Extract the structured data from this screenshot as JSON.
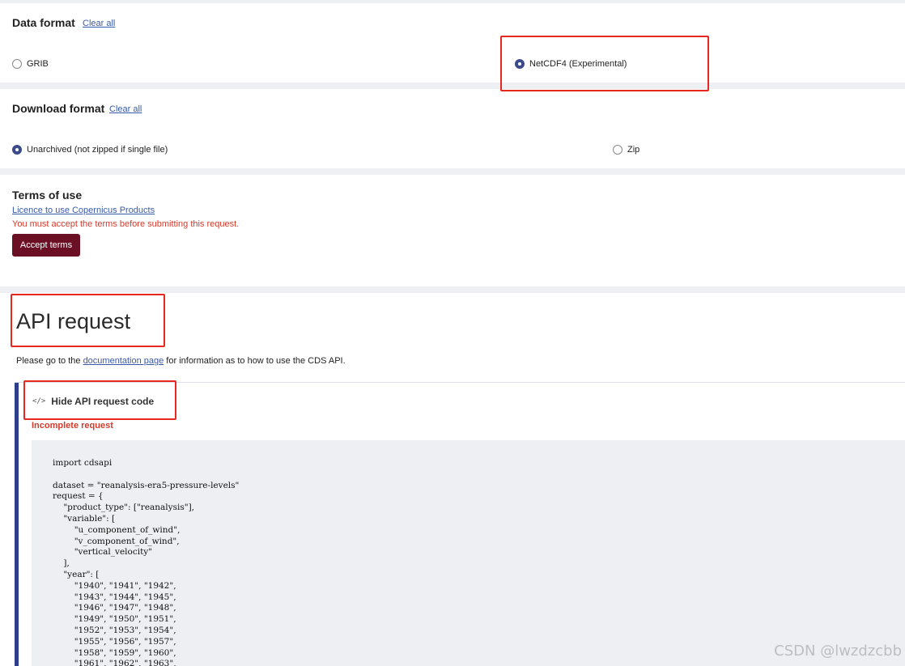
{
  "data_format": {
    "title": "Data format",
    "clear_label": "Clear all",
    "options": [
      {
        "label": "GRIB",
        "selected": false
      },
      {
        "label": "NetCDF4 (Experimental)",
        "selected": true
      }
    ]
  },
  "download_format": {
    "title": "Download format",
    "clear_label": "Clear all",
    "options": [
      {
        "label": "Unarchived (not zipped if single file)",
        "selected": true
      },
      {
        "label": "Zip",
        "selected": false
      }
    ]
  },
  "terms": {
    "title": "Terms of use",
    "licence_link": "Licence to use Copernicus Products",
    "warning": "You must accept the terms before submitting this request.",
    "accept_button": "Accept terms"
  },
  "api": {
    "title": "API request",
    "info_prefix": "Please go to the ",
    "info_link": "documentation page",
    "info_suffix": " for information as to how to use the CDS API.",
    "toggle_icon": "</>",
    "toggle_label": "Hide API request code",
    "status": "Incomplete request",
    "code": "import cdsapi\n\ndataset = \"reanalysis-era5-pressure-levels\"\nrequest = {\n    \"product_type\": [\"reanalysis\"],\n    \"variable\": [\n        \"u_component_of_wind\",\n        \"v_component_of_wind\",\n        \"vertical_velocity\"\n    ],\n    \"year\": [\n        \"1940\", \"1941\", \"1942\",\n        \"1943\", \"1944\", \"1945\",\n        \"1946\", \"1947\", \"1948\",\n        \"1949\", \"1950\", \"1951\",\n        \"1952\", \"1953\", \"1954\",\n        \"1955\", \"1956\", \"1957\",\n        \"1958\", \"1959\", \"1960\",\n        \"1961\", \"1962\", \"1963\","
  },
  "watermark": "CSDN @lwzdzcbb",
  "colors": {
    "accent": "#3a4a8a",
    "highlight": "#e8271f",
    "accept_button": "#6b1024",
    "warning": "#d33a2c",
    "code_bar": "#2c3f8c"
  }
}
